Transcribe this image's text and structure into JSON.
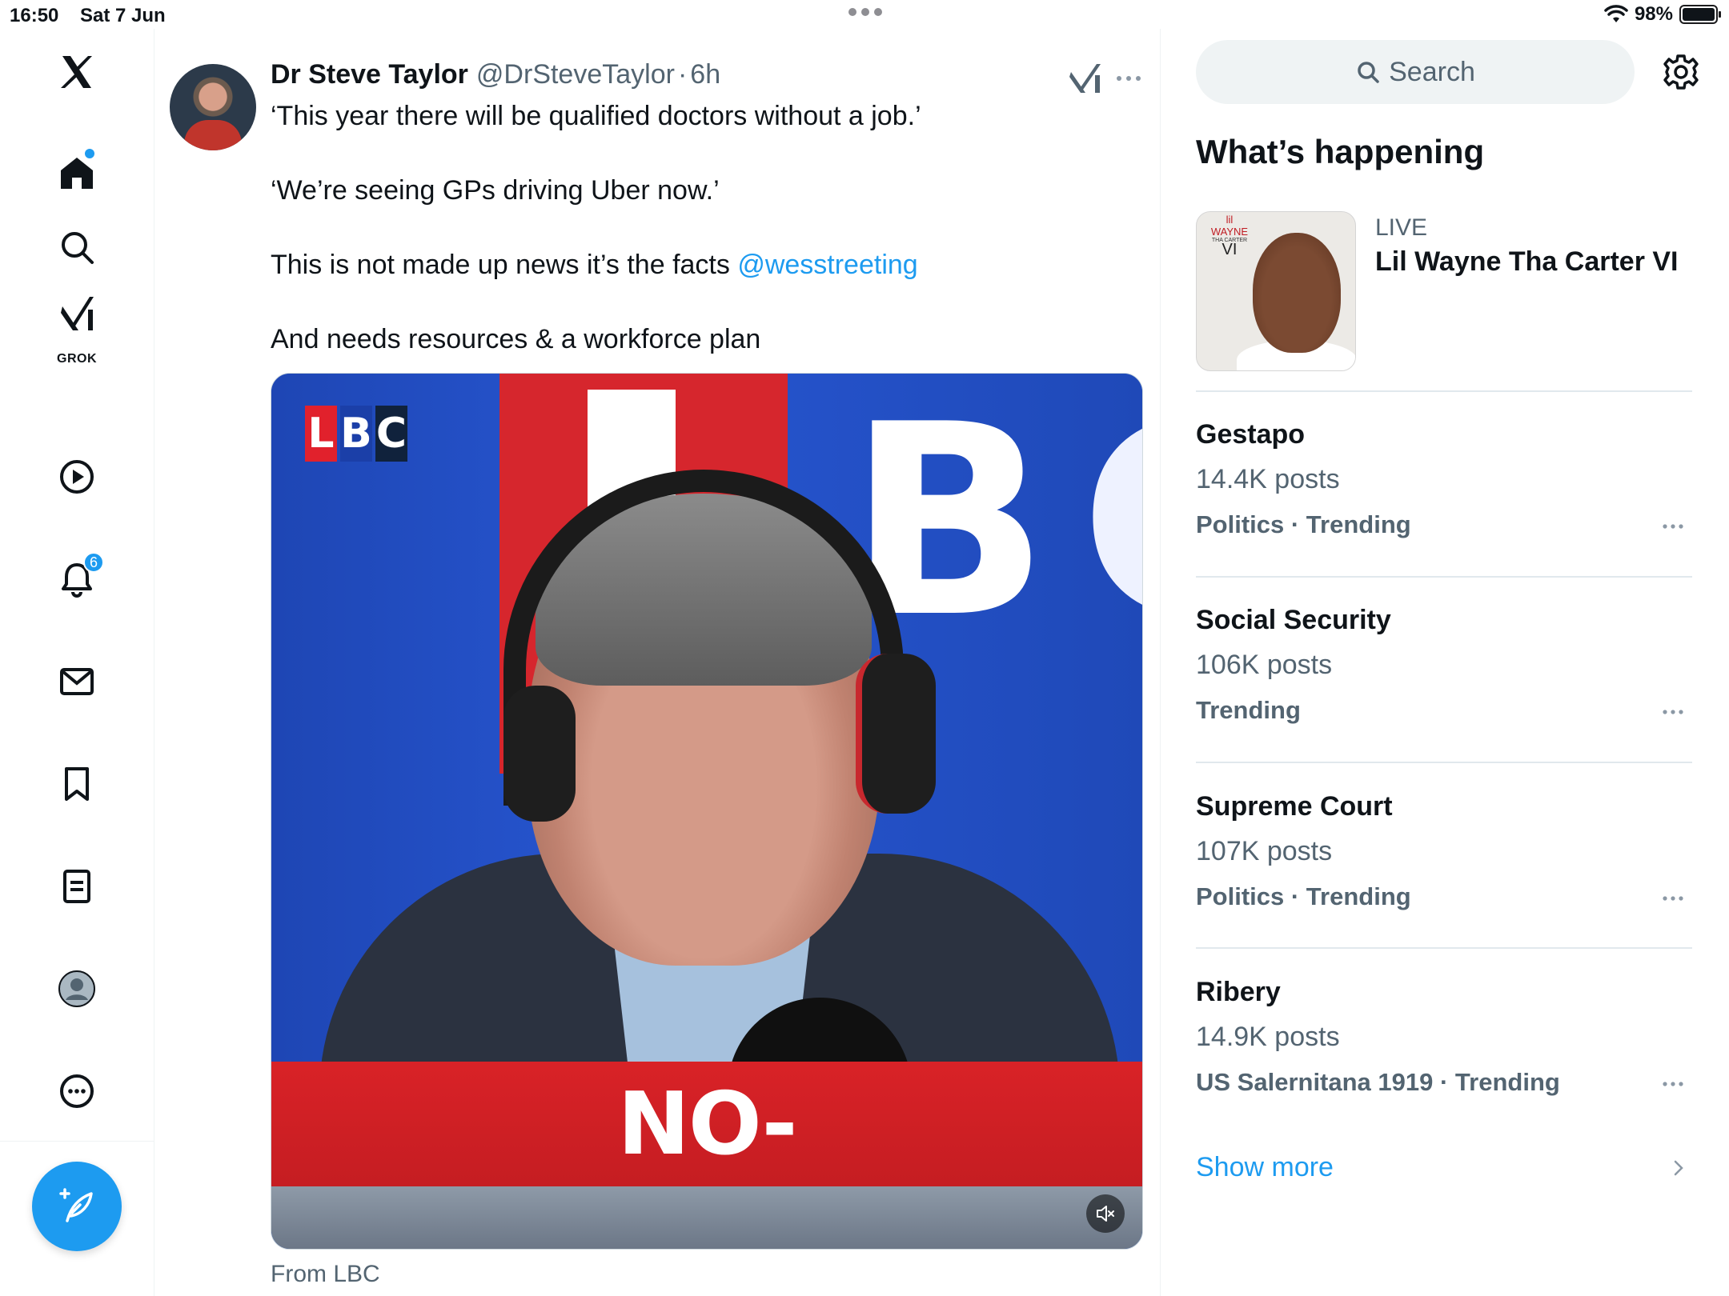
{
  "status_bar": {
    "time": "16:50",
    "date": "Sat 7 Jun",
    "battery": "98%"
  },
  "nav": {
    "notifications_badge": "6",
    "grok_label": "GROK"
  },
  "tweet": {
    "author_name": "Dr Steve Taylor",
    "author_handle": "@DrSteveTaylor",
    "separator": "·",
    "time": "6h",
    "line1": "‘This year there will be qualified doctors without a job.’",
    "line2": "‘We’re seeing GPs driving Uber now.’",
    "line3_prefix": "This is not made up news it’s the facts ",
    "line3_mention": "@wesstreeting",
    "line4": "And needs resources & a workforce plan",
    "video": {
      "logo_l": "L",
      "logo_b": "B",
      "logo_c": "C",
      "bg_letter_b": "B",
      "bg_letter_c": "C",
      "caption": "NO-"
    },
    "source": "From LBC"
  },
  "sidebar": {
    "search_placeholder": "Search",
    "section_title": "What’s happening",
    "live": {
      "label": "LIVE",
      "title": "Lil Wayne Tha Carter VI",
      "thumb_logo_top": "lil",
      "thumb_logo_mid": "WAYNE",
      "thumb_logo_small": "THA CARTER",
      "thumb_logo_vi": "VI"
    },
    "trends": [
      {
        "name": "Gestapo",
        "count": "14.4K posts",
        "meta": "Politics · Trending"
      },
      {
        "name": "Social Security",
        "count": "106K posts",
        "meta": "Trending"
      },
      {
        "name": "Supreme Court",
        "count": "107K posts",
        "meta": "Politics · Trending"
      },
      {
        "name": "Ribery",
        "count": "14.9K posts",
        "meta": "US Salernitana 1919 · Trending"
      }
    ],
    "show_more": "Show more"
  },
  "colors": {
    "accent": "#1d9bf0",
    "text_primary": "#0f1419",
    "text_secondary": "#536471",
    "lbc_red": "#d92227"
  }
}
